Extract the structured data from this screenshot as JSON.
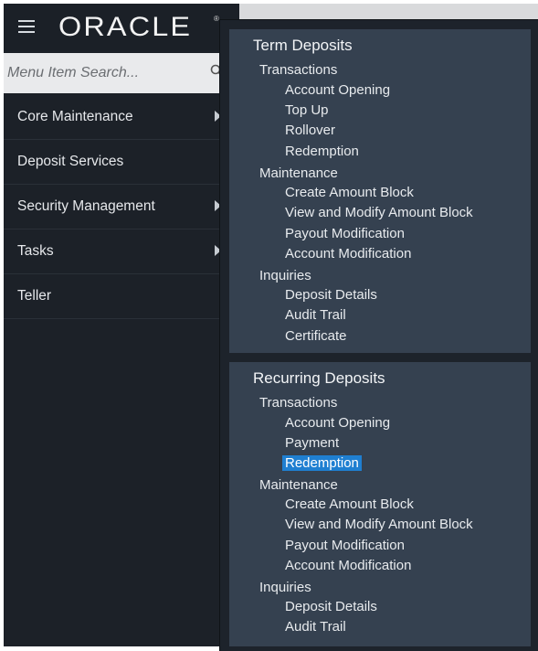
{
  "brand": {
    "logo_text": "ORACLE",
    "logo_mark": "®"
  },
  "search": {
    "placeholder": "Menu Item Search..."
  },
  "sidebar": {
    "items": [
      {
        "label": "Core Maintenance",
        "has_submenu": true
      },
      {
        "label": "Deposit Services",
        "has_submenu": false
      },
      {
        "label": "Security Management",
        "has_submenu": true
      },
      {
        "label": "Tasks",
        "has_submenu": true
      },
      {
        "label": "Teller",
        "has_submenu": false
      }
    ]
  },
  "flyout": {
    "term": {
      "title": "Term Deposits",
      "transactions_label": "Transactions",
      "transactions": [
        "Account Opening",
        "Top Up",
        "Rollover",
        "Redemption"
      ],
      "maintenance_label": "Maintenance",
      "maintenance": [
        "Create Amount Block",
        "View and Modify Amount Block",
        "Payout Modification",
        "Account Modification"
      ],
      "inquiries_label": "Inquiries",
      "inquiries": [
        "Deposit Details",
        "Audit Trail",
        "Certificate"
      ]
    },
    "recurring": {
      "title": "Recurring Deposits",
      "transactions_label": "Transactions",
      "transactions": [
        "Account Opening",
        "Payment",
        "Redemption"
      ],
      "selected": "Redemption",
      "maintenance_label": "Maintenance",
      "maintenance": [
        "Create Amount Block",
        "View and Modify Amount Block",
        "Payout Modification",
        "Account Modification"
      ],
      "inquiries_label": "Inquiries",
      "inquiries": [
        "Deposit Details",
        "Audit Trail"
      ]
    }
  },
  "colors": {
    "sidebar_bg": "#1c2128",
    "panel_bg": "#354150",
    "selected_bg": "#1f7fd1"
  }
}
